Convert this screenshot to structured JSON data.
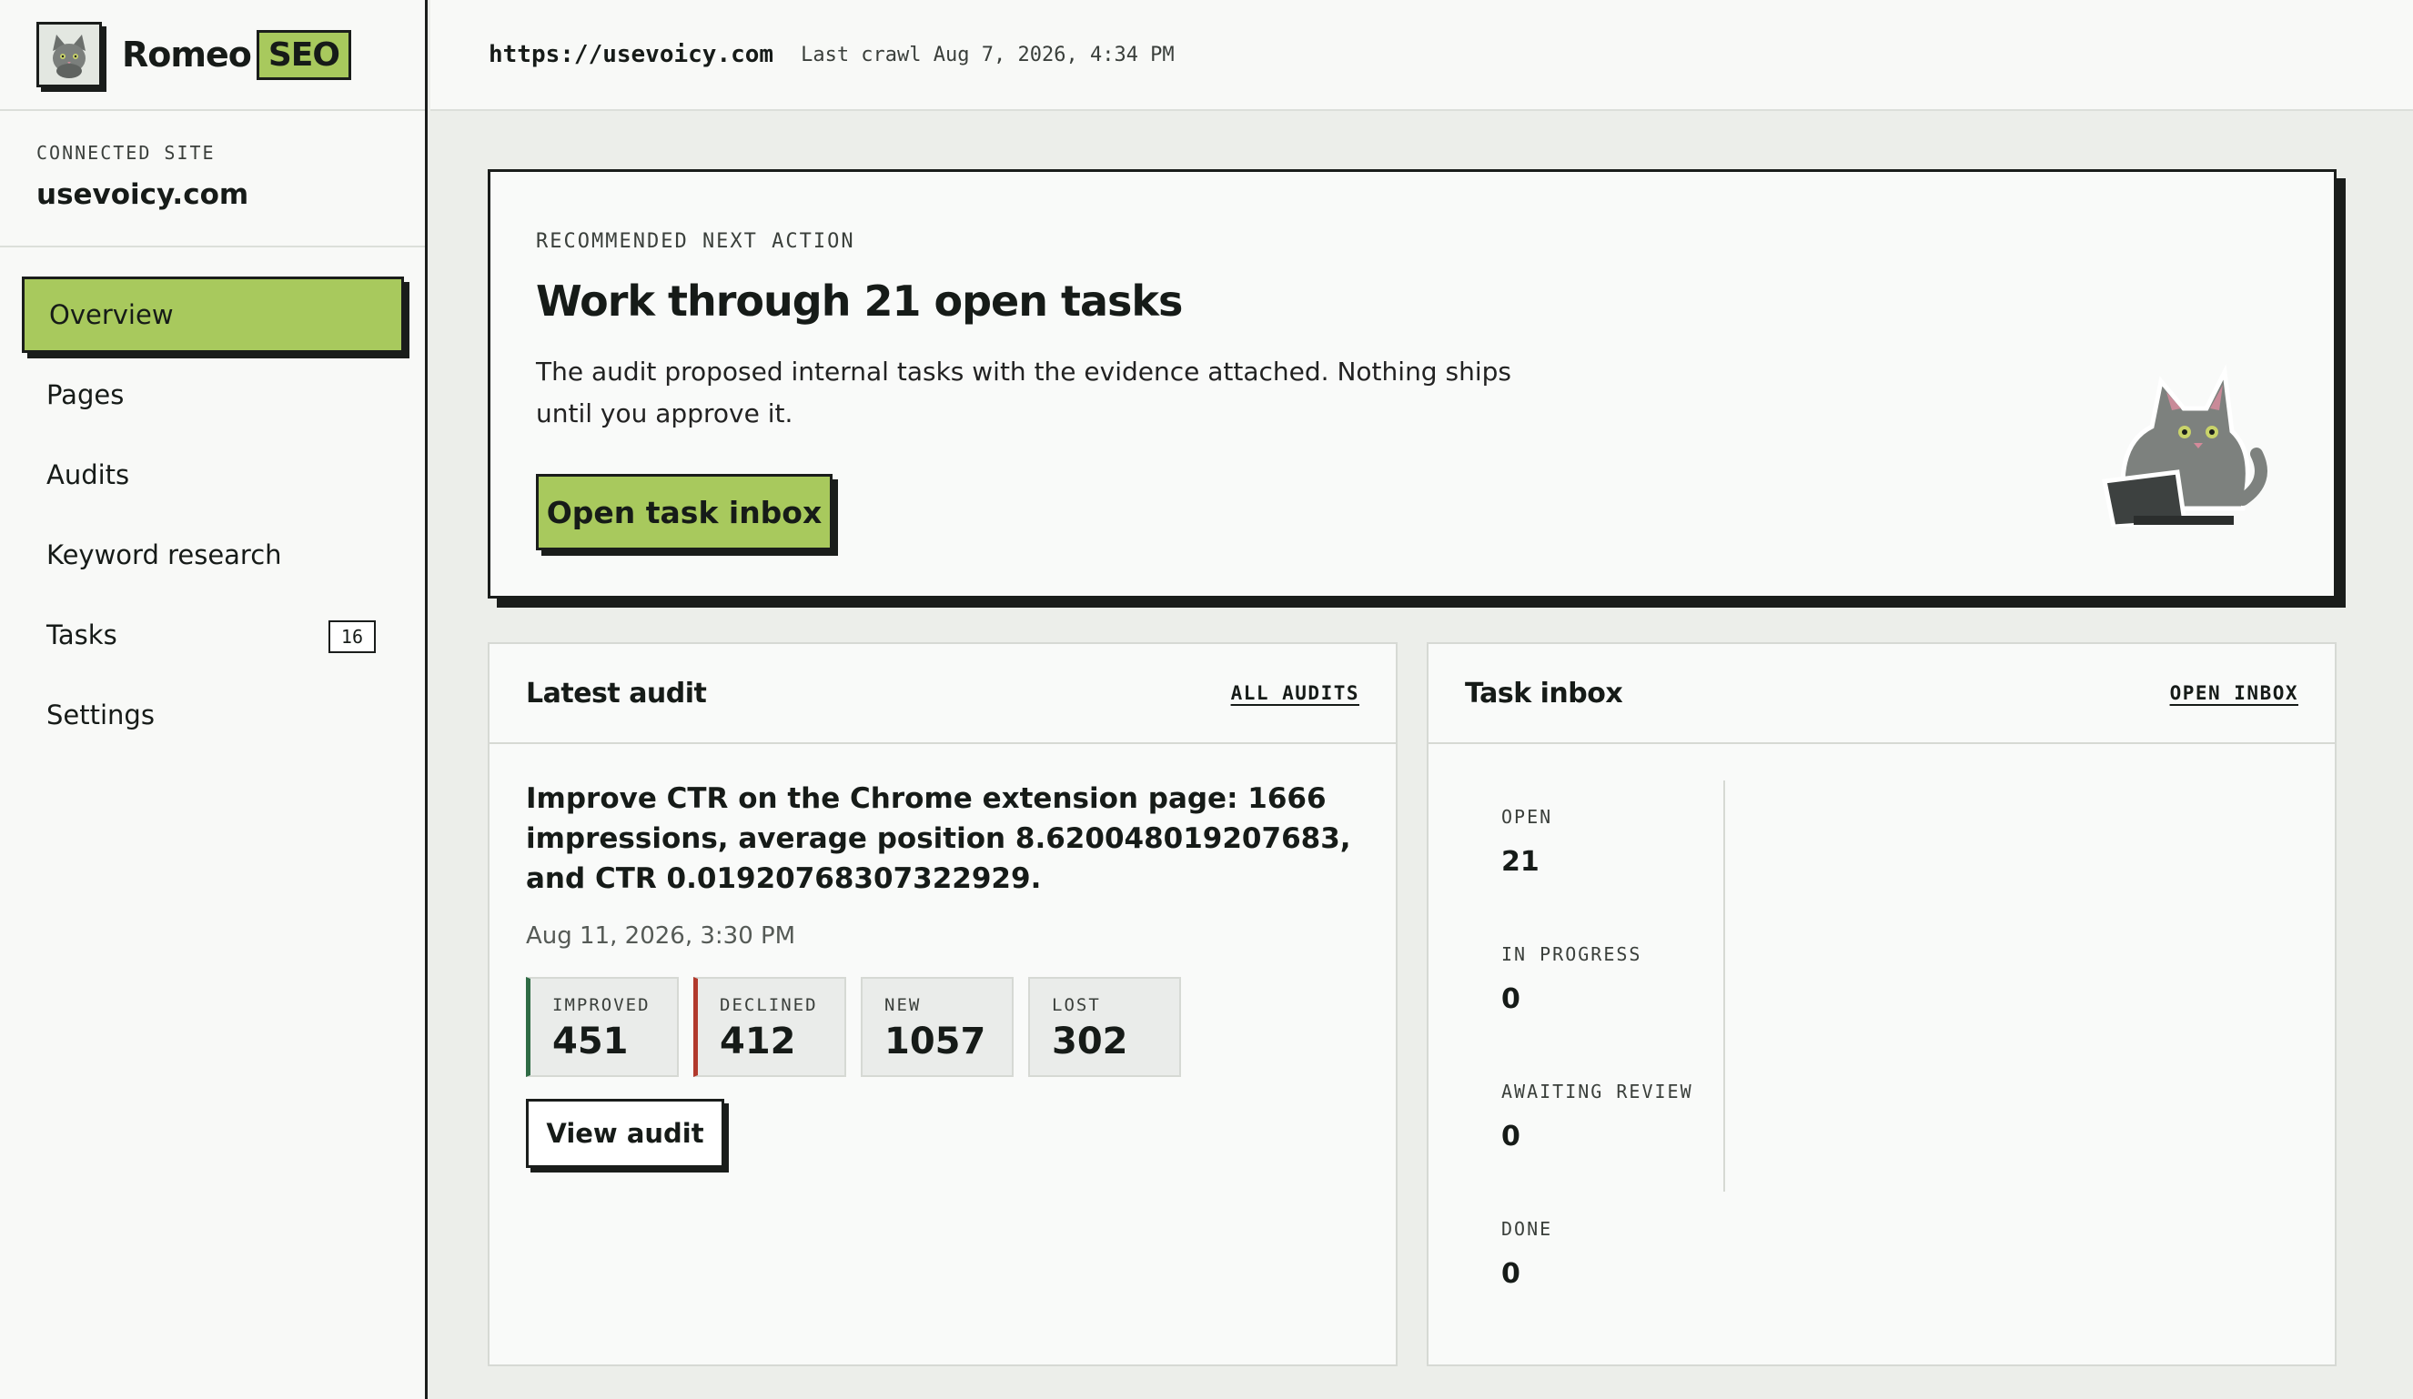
{
  "brand": {
    "name": "Romeo",
    "tag": "SEO",
    "logo_icon": "cat-logo-icon"
  },
  "site": {
    "label": "CONNECTED SITE",
    "name": "usevoicy.com"
  },
  "nav": {
    "items": [
      {
        "label": "Overview",
        "active": true
      },
      {
        "label": "Pages"
      },
      {
        "label": "Audits"
      },
      {
        "label": "Keyword research"
      },
      {
        "label": "Tasks",
        "badge": "16"
      },
      {
        "label": "Settings"
      }
    ]
  },
  "topbar": {
    "url": "https://usevoicy.com",
    "crawl": "Last crawl Aug 7, 2026, 4:34 PM"
  },
  "hero": {
    "label": "RECOMMENDED NEXT ACTION",
    "title": "Work through 21 open tasks",
    "description": "The audit proposed internal tasks with the evidence attached. Nothing ships until you approve it.",
    "button": "Open task inbox",
    "illustration_icon": "cat-laptop-icon"
  },
  "audit_panel": {
    "title": "Latest audit",
    "link": "ALL AUDITS",
    "headline": "Improve CTR on the Chrome extension page: 1666 impressions, average position 8.620048019207683, and CTR 0.01920768307322929.",
    "date": "Aug 11, 2026, 3:30 PM",
    "stats": [
      {
        "label": "IMPROVED",
        "value": "451"
      },
      {
        "label": "DECLINED",
        "value": "412"
      },
      {
        "label": "NEW",
        "value": "1057"
      },
      {
        "label": "LOST",
        "value": "302"
      }
    ],
    "button": "View audit"
  },
  "inbox_panel": {
    "title": "Task inbox",
    "link": "OPEN INBOX",
    "stats": [
      {
        "label": "OPEN",
        "value": "21"
      },
      {
        "label": "IN PROGRESS",
        "value": "0"
      },
      {
        "label": "AWAITING REVIEW",
        "value": "0"
      },
      {
        "label": "DONE",
        "value": "0"
      }
    ]
  },
  "colors": {
    "accent": "#a8c95d",
    "ink": "#1a1d1b",
    "improved": "#2f6b45",
    "declined": "#b1392c",
    "background": "#eceeea"
  }
}
